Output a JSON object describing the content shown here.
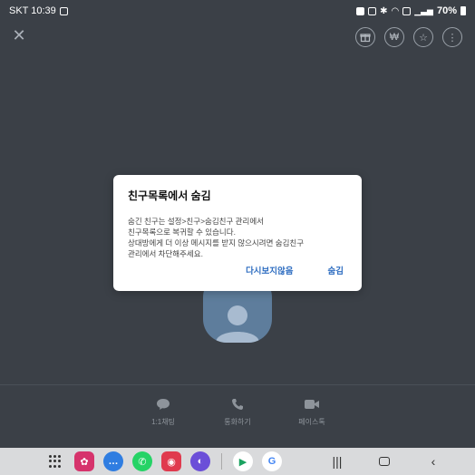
{
  "status_bar": {
    "carrier_time": "SKT 10:39",
    "battery": "70%"
  },
  "top_bar": {
    "close_icon": "close-icon",
    "actions": [
      {
        "name": "gift-icon",
        "glyph": "⌂"
      },
      {
        "name": "won-icon",
        "glyph": "₩"
      },
      {
        "name": "star-icon",
        "glyph": "☆"
      },
      {
        "name": "more-icon",
        "glyph": "⋮"
      }
    ]
  },
  "dialog": {
    "title": "친구목록에서 숨김",
    "body_lines": [
      "숨긴 친구는 설정>친구>숨김친구 관리에서",
      "친구목록으로 복귀할 수 있습니다.",
      "상대방에게 더 이상 메시지를 받지 않으시려면 숨김친구",
      "관리에서 차단해주세요."
    ],
    "dont_show_again": "다시보지않음",
    "hide": "숨김"
  },
  "profile_actions": [
    {
      "icon": "chat-icon",
      "label": "1:1채팅"
    },
    {
      "icon": "phone-icon",
      "label": "통화하기"
    },
    {
      "icon": "video-icon",
      "label": "페이스톡"
    }
  ],
  "nav_apps": [
    {
      "name": "flower-app-icon",
      "color": "#d6336c",
      "glyph": "✿"
    },
    {
      "name": "messages-app-icon",
      "color": "#2f7de1",
      "glyph": "…"
    },
    {
      "name": "whatsapp-app-icon",
      "color": "#25d366",
      "glyph": "✆"
    },
    {
      "name": "camera-app-icon",
      "color": "#e03a4e",
      "glyph": "◉"
    },
    {
      "name": "internet-app-icon",
      "color": "#6b4fd8",
      "glyph": "◐"
    },
    {
      "name": "play-store-app-icon",
      "color": "#ffffff",
      "glyph": "▶"
    },
    {
      "name": "google-app-icon",
      "color": "#ffffff",
      "glyph": "G"
    }
  ],
  "colors": {
    "background": "#3b4047",
    "dialog_button": "#2f6ec1",
    "avatar": "#5e7d9c"
  }
}
